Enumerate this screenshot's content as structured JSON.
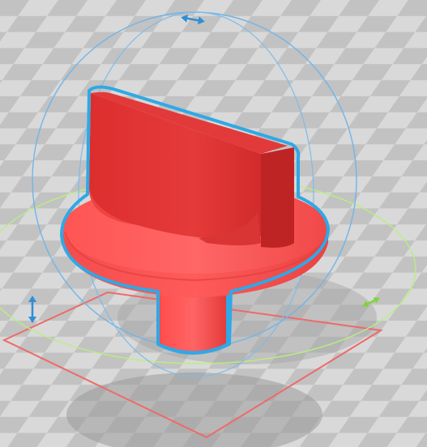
{
  "app": {
    "view": "3d-viewport",
    "mode": "rotate"
  },
  "colors": {
    "floor_light": "#d7d7d7",
    "floor_dark": "#bdbdbd",
    "model_red": "#ef3b3b",
    "model_red_light": "#ff5a5a",
    "model_red_dark": "#c92626",
    "selection_outline": "#2fa8e6",
    "rotate_ring_blue": "#6fb6ea",
    "rotate_ring_green": "#b7ef7d",
    "bounding_box": "#ee6a6a",
    "shadow": "#9f9f9f"
  },
  "icons": {
    "rotate_handle_top": "double-arrow-icon",
    "rotate_handle_left": "double-arrow-icon",
    "rotate_handle_right": "double-arrow-icon"
  }
}
